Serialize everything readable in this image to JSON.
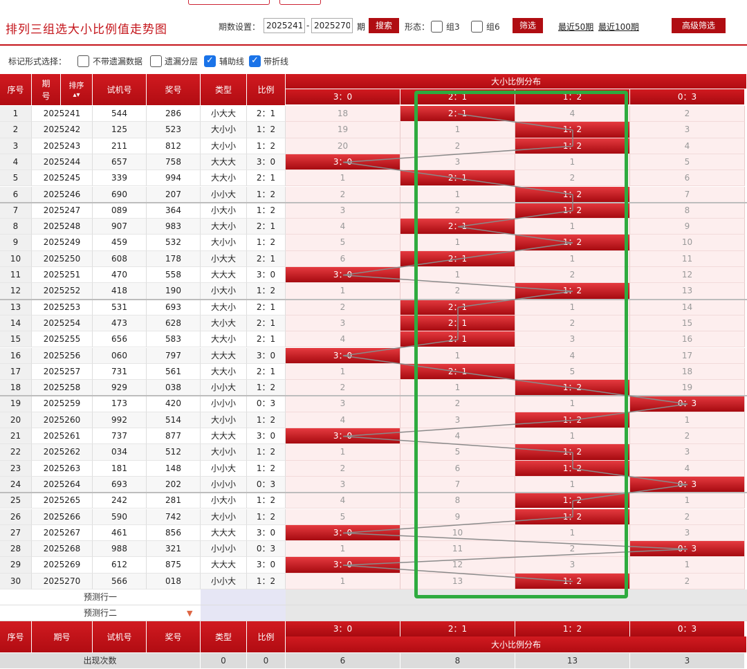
{
  "header": {
    "title": "排列三组选大小比例值走势图",
    "period_label": "期数设置：",
    "period_start": "2025241",
    "period_dash": "-",
    "period_end": "2025270",
    "period_unit": "期",
    "search_button": "搜索",
    "shape_label": "形态：",
    "group3_label": "组3",
    "group6_label": "组6",
    "filter_button": "筛选",
    "recent50_link": "最近50期",
    "recent100_link": "最近100期",
    "advanced_button": "高级筛选"
  },
  "marks": {
    "label": "标记形式选择：",
    "options": [
      {
        "label": "不带遗漏数据",
        "checked": false
      },
      {
        "label": "遗漏分层",
        "checked": false
      },
      {
        "label": "辅助线",
        "checked": true
      },
      {
        "label": "带折线",
        "checked": true
      }
    ]
  },
  "table": {
    "headers": {
      "seq": "序号",
      "period": "期号",
      "sort": "排序",
      "trial": "试机号",
      "prize": "奖号",
      "type": "类型",
      "ratio": "比例",
      "dist_title": "大小比例分布"
    },
    "dist_columns": [
      "3：0",
      "2：1",
      "1：2",
      "0：3"
    ],
    "rows": [
      {
        "seq": "1",
        "period": "2025241",
        "trial": "544",
        "prize": "286",
        "type": "小大大",
        "ratio": "2：1",
        "dist": [
          "18",
          "2：1",
          "4",
          "2"
        ],
        "hit": 1
      },
      {
        "seq": "2",
        "period": "2025242",
        "trial": "125",
        "prize": "523",
        "type": "大小小",
        "ratio": "1：2",
        "dist": [
          "19",
          "1",
          "1：2",
          "3"
        ],
        "hit": 2
      },
      {
        "seq": "3",
        "period": "2025243",
        "trial": "211",
        "prize": "812",
        "type": "大小小",
        "ratio": "1：2",
        "dist": [
          "20",
          "2",
          "1：2",
          "4"
        ],
        "hit": 2
      },
      {
        "seq": "4",
        "period": "2025244",
        "trial": "657",
        "prize": "758",
        "type": "大大大",
        "ratio": "3：0",
        "dist": [
          "3：0",
          "3",
          "1",
          "5"
        ],
        "hit": 0
      },
      {
        "seq": "5",
        "period": "2025245",
        "trial": "339",
        "prize": "994",
        "type": "大大小",
        "ratio": "2：1",
        "dist": [
          "1",
          "2：1",
          "2",
          "6"
        ],
        "hit": 1
      },
      {
        "seq": "6",
        "period": "2025246",
        "trial": "690",
        "prize": "207",
        "type": "小小大",
        "ratio": "1：2",
        "dist": [
          "2",
          "1",
          "1：2",
          "7"
        ],
        "hit": 2
      },
      {
        "seq": "7",
        "period": "2025247",
        "trial": "089",
        "prize": "364",
        "type": "小大小",
        "ratio": "1：2",
        "dist": [
          "3",
          "2",
          "1：2",
          "8"
        ],
        "hit": 2
      },
      {
        "seq": "8",
        "period": "2025248",
        "trial": "907",
        "prize": "983",
        "type": "大大小",
        "ratio": "2：1",
        "dist": [
          "4",
          "2：1",
          "1",
          "9"
        ],
        "hit": 1
      },
      {
        "seq": "9",
        "period": "2025249",
        "trial": "459",
        "prize": "532",
        "type": "大小小",
        "ratio": "1：2",
        "dist": [
          "5",
          "1",
          "1：2",
          "10"
        ],
        "hit": 2
      },
      {
        "seq": "10",
        "period": "2025250",
        "trial": "608",
        "prize": "178",
        "type": "小大大",
        "ratio": "2：1",
        "dist": [
          "6",
          "2：1",
          "1",
          "11"
        ],
        "hit": 1
      },
      {
        "seq": "11",
        "period": "2025251",
        "trial": "470",
        "prize": "558",
        "type": "大大大",
        "ratio": "3：0",
        "dist": [
          "3：0",
          "1",
          "2",
          "12"
        ],
        "hit": 0
      },
      {
        "seq": "12",
        "period": "2025252",
        "trial": "418",
        "prize": "190",
        "type": "小大小",
        "ratio": "1：2",
        "dist": [
          "1",
          "2",
          "1：2",
          "13"
        ],
        "hit": 2
      },
      {
        "seq": "13",
        "period": "2025253",
        "trial": "531",
        "prize": "693",
        "type": "大大小",
        "ratio": "2：1",
        "dist": [
          "2",
          "2：1",
          "1",
          "14"
        ],
        "hit": 1
      },
      {
        "seq": "14",
        "period": "2025254",
        "trial": "473",
        "prize": "628",
        "type": "大小大",
        "ratio": "2：1",
        "dist": [
          "3",
          "2：1",
          "2",
          "15"
        ],
        "hit": 1
      },
      {
        "seq": "15",
        "period": "2025255",
        "trial": "656",
        "prize": "583",
        "type": "大大小",
        "ratio": "2：1",
        "dist": [
          "4",
          "2：1",
          "3",
          "16"
        ],
        "hit": 1
      },
      {
        "seq": "16",
        "period": "2025256",
        "trial": "060",
        "prize": "797",
        "type": "大大大",
        "ratio": "3：0",
        "dist": [
          "3：0",
          "1",
          "4",
          "17"
        ],
        "hit": 0
      },
      {
        "seq": "17",
        "period": "2025257",
        "trial": "731",
        "prize": "561",
        "type": "大大小",
        "ratio": "2：1",
        "dist": [
          "1",
          "2：1",
          "5",
          "18"
        ],
        "hit": 1
      },
      {
        "seq": "18",
        "period": "2025258",
        "trial": "929",
        "prize": "038",
        "type": "小小大",
        "ratio": "1：2",
        "dist": [
          "2",
          "1",
          "1：2",
          "19"
        ],
        "hit": 2
      },
      {
        "seq": "19",
        "period": "2025259",
        "trial": "173",
        "prize": "420",
        "type": "小小小",
        "ratio": "0：3",
        "dist": [
          "3",
          "2",
          "1",
          "0：3"
        ],
        "hit": 3
      },
      {
        "seq": "20",
        "period": "2025260",
        "trial": "992",
        "prize": "514",
        "type": "大小小",
        "ratio": "1：2",
        "dist": [
          "4",
          "3",
          "1：2",
          "1"
        ],
        "hit": 2
      },
      {
        "seq": "21",
        "period": "2025261",
        "trial": "737",
        "prize": "877",
        "type": "大大大",
        "ratio": "3：0",
        "dist": [
          "3：0",
          "4",
          "1",
          "2"
        ],
        "hit": 0
      },
      {
        "seq": "22",
        "period": "2025262",
        "trial": "034",
        "prize": "512",
        "type": "大小小",
        "ratio": "1：2",
        "dist": [
          "1",
          "5",
          "1：2",
          "3"
        ],
        "hit": 2
      },
      {
        "seq": "23",
        "period": "2025263",
        "trial": "181",
        "prize": "148",
        "type": "小小大",
        "ratio": "1：2",
        "dist": [
          "2",
          "6",
          "1：2",
          "4"
        ],
        "hit": 2
      },
      {
        "seq": "24",
        "period": "2025264",
        "trial": "693",
        "prize": "202",
        "type": "小小小",
        "ratio": "0：3",
        "dist": [
          "3",
          "7",
          "1",
          "0：3"
        ],
        "hit": 3
      },
      {
        "seq": "25",
        "period": "2025265",
        "trial": "242",
        "prize": "281",
        "type": "小大小",
        "ratio": "1：2",
        "dist": [
          "4",
          "8",
          "1：2",
          "1"
        ],
        "hit": 2
      },
      {
        "seq": "26",
        "period": "2025266",
        "trial": "590",
        "prize": "742",
        "type": "大小小",
        "ratio": "1：2",
        "dist": [
          "5",
          "9",
          "1：2",
          "2"
        ],
        "hit": 2
      },
      {
        "seq": "27",
        "period": "2025267",
        "trial": "461",
        "prize": "856",
        "type": "大大大",
        "ratio": "3：0",
        "dist": [
          "3：0",
          "10",
          "1",
          "3"
        ],
        "hit": 0
      },
      {
        "seq": "28",
        "period": "2025268",
        "trial": "988",
        "prize": "321",
        "type": "小小小",
        "ratio": "0：3",
        "dist": [
          "1",
          "11",
          "2",
          "0：3"
        ],
        "hit": 3
      },
      {
        "seq": "29",
        "period": "2025269",
        "trial": "612",
        "prize": "875",
        "type": "大大大",
        "ratio": "3：0",
        "dist": [
          "3：0",
          "12",
          "3",
          "1"
        ],
        "hit": 0
      },
      {
        "seq": "30",
        "period": "2025270",
        "trial": "566",
        "prize": "018",
        "type": "小小大",
        "ratio": "1：2",
        "dist": [
          "1",
          "13",
          "1：2",
          "2"
        ],
        "hit": 2
      }
    ],
    "predict_rows": [
      "预测行一",
      "预测行二"
    ],
    "footer": {
      "label": "出现次数",
      "type_count": "0",
      "ratio_count": "0",
      "dist_counts": [
        "6",
        "8",
        "13",
        "3"
      ]
    }
  },
  "colors": {
    "brand_red": "#c4141a",
    "highlight_green": "#2eab3f",
    "checkbox_blue": "#1a73e8"
  }
}
